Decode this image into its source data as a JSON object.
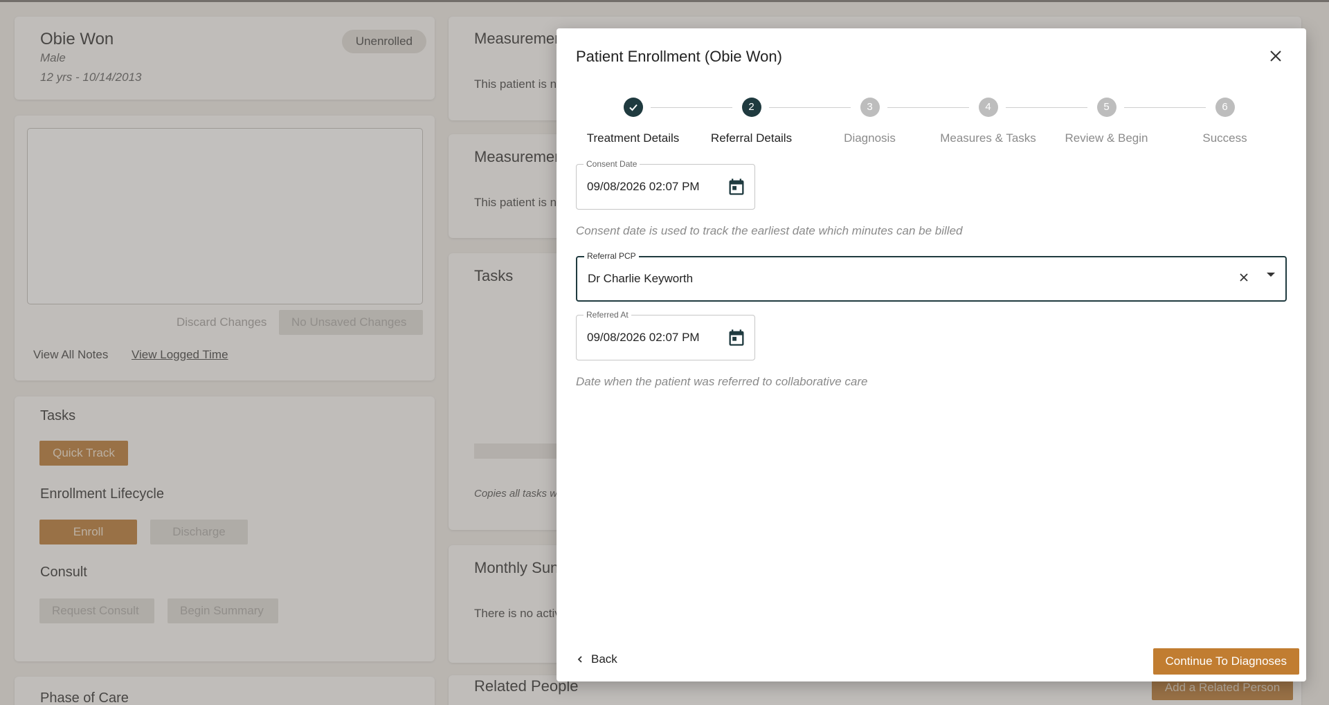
{
  "patient": {
    "name": "Obie Won",
    "gender": "Male",
    "age_dob": "12 yrs - 10/14/2013",
    "status": "Unenrolled"
  },
  "notes": {
    "discard_label": "Discard Changes",
    "save_label": "No Unsaved Changes",
    "view_all_notes": "View All Notes",
    "view_logged_time": "View Logged Time"
  },
  "left_tasks": {
    "title": "Tasks",
    "quick_track": "Quick Track",
    "lifecycle_title": "Enrollment Lifecycle",
    "enroll": "Enroll",
    "discharge": "Discharge",
    "consult_title": "Consult",
    "request_consult": "Request Consult",
    "begin_summary": "Begin Summary",
    "phase_title": "Phase of Care"
  },
  "right_cards": {
    "measurement1_title": "Measuremen",
    "measurement1_text": "This patient is n",
    "measurement2_title": "Measuremen",
    "measurement2_text": "This patient is n",
    "tasks_title": "Tasks",
    "tasks_note": "Copies all tasks w",
    "monthly_title": "Monthly Sun",
    "monthly_text": "There is no activ",
    "related_title": "Related People",
    "add_related": "Add a Related Person"
  },
  "modal": {
    "title": "Patient Enrollment (Obie Won)",
    "steps": [
      {
        "number": "1",
        "label": "Treatment Details",
        "state": "done"
      },
      {
        "number": "2",
        "label": "Referral Details",
        "state": "active"
      },
      {
        "number": "3",
        "label": "Diagnosis",
        "state": "pending"
      },
      {
        "number": "4",
        "label": "Measures & Tasks",
        "state": "pending"
      },
      {
        "number": "5",
        "label": "Review & Begin",
        "state": "pending"
      },
      {
        "number": "6",
        "label": "Success",
        "state": "pending"
      }
    ],
    "consent_date": {
      "label": "Consent Date",
      "value": "09/08/2026 02:07 PM",
      "helper": "Consent date is used to track the earliest date which minutes can be billed"
    },
    "referral_pcp": {
      "label": "Referral PCP",
      "value": "Dr Charlie Keyworth"
    },
    "referred_at": {
      "label": "Referred At",
      "value": "09/08/2026 02:07 PM",
      "helper": "Date when the patient was referred to collaborative care"
    },
    "back_label": "Back",
    "continue_label": "Continue To Diagnoses"
  },
  "colors": {
    "accent_brown": "#c17d31",
    "stepper_dark": "#1f3a3f"
  }
}
